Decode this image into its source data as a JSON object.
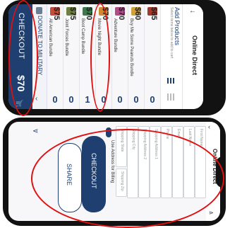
{
  "top": {
    "header_title": "Online Direct",
    "add_products": "Add Products",
    "add_products_sub": "Select items below to add to cart",
    "checkout_label": "CHECKOUT",
    "total": "$70",
    "donate_label": "DONATE TO MILITARY",
    "products": [
      {
        "name": "All American Bundle",
        "price": "$75",
        "qty": "0",
        "color": "#c54b3a"
      },
      {
        "name": "Joint Forces Bundle",
        "price": "$75",
        "qty": "0",
        "color": "#6f7f3d"
      },
      {
        "name": "Boot Camp Bundle",
        "price": "$70",
        "qty": "1",
        "color": "#3c7a4b"
      },
      {
        "name": "Movie Night Bundle",
        "price": "$70",
        "qty": "0",
        "color": "#cf8a2e"
      },
      {
        "name": "Adventure Bundle",
        "price": "$70",
        "qty": "0",
        "color": "#b44a8a"
      },
      {
        "name": "Buy Me Some Peanuts Bundle",
        "price": "$60",
        "qty": "0",
        "color": "#d0a13a"
      },
      {
        "name": "",
        "price": "$65",
        "qty": "0",
        "color": "#a23a2e"
      }
    ]
  },
  "bottom": {
    "header_title": "Online Direct",
    "fields": [
      "First Name",
      "Last Name",
      "Email",
      "Phone",
      "Shipping Address 1",
      "Shipping Address 2",
      "Shipping City",
      "Shipping State"
    ],
    "shipping_zip": "Shipping Zip",
    "billing_toggle": "Use Address for Billing",
    "checkout_button": "CHECKOUT",
    "share_button": "SHARE"
  },
  "colors": {
    "accent": "#1f3f70",
    "annotation": "#e01010"
  }
}
